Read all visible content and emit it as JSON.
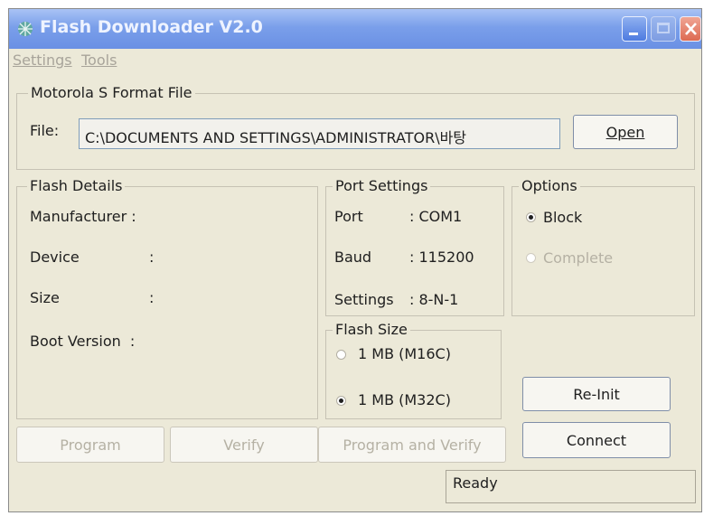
{
  "window": {
    "title": "Flash Downloader V2.0"
  },
  "menu": {
    "settings": "Settings",
    "tools": "Tools"
  },
  "file_group": {
    "legend": "Motorola S Format File",
    "label": "File:",
    "path": "C:\\DOCUMENTS AND SETTINGS\\ADMINISTRATOR\\바탕",
    "open_button": "Open"
  },
  "flash_details": {
    "legend": "Flash Details",
    "manufacturer": "Manufacturer :",
    "device": "Device",
    "size": "Size",
    "boot_version": "Boot Version  :",
    "colon": ":"
  },
  "port_settings": {
    "legend": "Port Settings",
    "port_label": "Port",
    "port_value": ": COM1",
    "baud_label": "Baud",
    "baud_value": ": 115200",
    "settings_label": "Settings",
    "settings_value": ": 8-N-1"
  },
  "options": {
    "legend": "Options",
    "block": "Block",
    "complete": "Complete",
    "selected": "Block"
  },
  "flash_size": {
    "legend": "Flash Size",
    "opt1": "1 MB (M16C)",
    "opt2": "1 MB (M32C)",
    "selected": "1 MB (M32C)"
  },
  "buttons": {
    "reinit": "Re-Init",
    "connect": "Connect",
    "program": "Program",
    "verify": "Verify",
    "program_verify": "Program and Verify"
  },
  "status": "Ready",
  "colors": {
    "title_gradient_top": "#a9c3f5",
    "window_bg": "#ece9d8",
    "close_button": "#dd6a52"
  }
}
